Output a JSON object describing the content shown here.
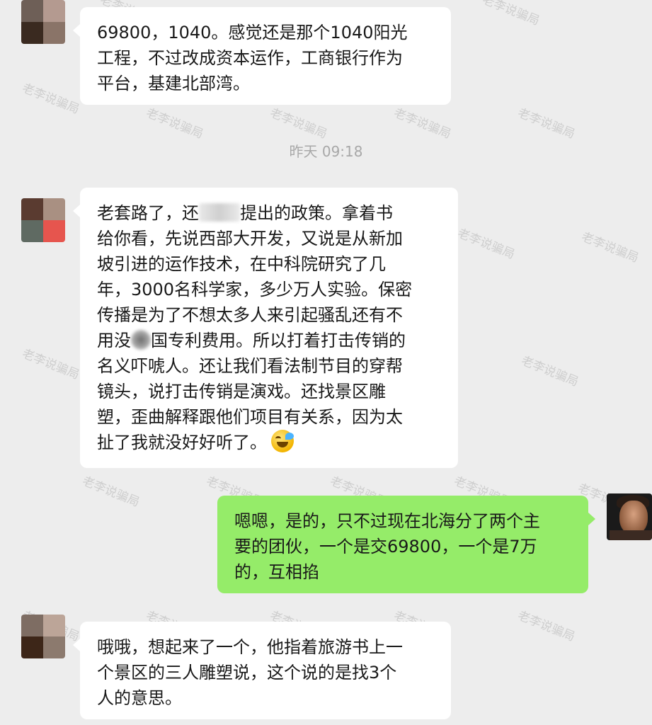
{
  "watermark": "老李说骗局",
  "timestamp": "昨天 09:18",
  "messages": [
    {
      "side": "left",
      "lines": [
        "69800，1040。感觉还是那个1040阳光",
        "工程，不过改成资本运作，工商银行作为",
        "平台，基建北部湾。"
      ]
    },
    {
      "side": "left",
      "lines": [
        "老套路了，还",
        "提出的政策。拿着书",
        "给你看，先说西部大开发，又说是从新加",
        "坡引进的运作技术，在中科院研究了几",
        "年，3000名科学家，多少万人实验。保密",
        "传播是为了不想太多人来引起骚乱还有不",
        "用没",
        "国专利费用。所以打着打击传销的",
        "名义吓唬人。还让我们看法制节目的穿帮",
        "镜头，说打击传销是演戏。还找景区雕",
        "塑，歪曲解释跟他们项目有关系，因为太",
        "扯了我就没好好听了。"
      ]
    },
    {
      "side": "right",
      "lines": [
        "嗯嗯，是的，只不过现在北海分了两个主",
        "要的团伙，一个是交69800，一个是7万",
        "的，互相掐"
      ]
    },
    {
      "side": "left",
      "lines": [
        "哦哦，想起来了一个，他指着旅游书上一",
        "个景区的三人雕塑说，这个说的是找3个",
        "人的意思。"
      ]
    }
  ],
  "colors": {
    "background": "#ededed",
    "bubble_left": "#ffffff",
    "bubble_right": "#95ec69",
    "timestamp": "#a8a8a8"
  }
}
